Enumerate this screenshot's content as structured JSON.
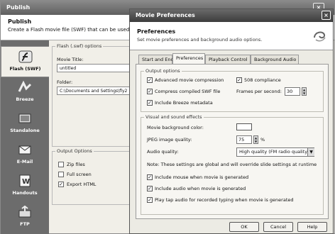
{
  "publish": {
    "title": "Publish",
    "header_title": "Publish",
    "header_subtitle": "Create a Flash movie file (SWF) that can be used indo",
    "close_glyph": "×",
    "sidebar": [
      {
        "label": "Flash (SWF)",
        "icon": "flash-icon",
        "active": true
      },
      {
        "label": "Breeze",
        "icon": "breeze-icon",
        "active": false
      },
      {
        "label": "Standalone",
        "icon": "standalone-icon",
        "active": false
      },
      {
        "label": "E-Mail",
        "icon": "email-icon",
        "active": false
      },
      {
        "label": "Handouts",
        "icon": "handouts-icon",
        "active": false
      },
      {
        "label": "FTP",
        "icon": "ftp-icon",
        "active": false
      }
    ],
    "flash_options": {
      "legend": "Flash (.swf) options",
      "movie_title_label": "Movie Title:",
      "movie_title_value": "untitled",
      "folder_label": "Folder:",
      "folder_value": "C:\\Documents and Settings\\fly2"
    },
    "output_options": {
      "legend": "Output Options",
      "items": [
        {
          "label": "Zip files",
          "checked": false
        },
        {
          "label": "Full screen",
          "checked": false
        },
        {
          "label": "Export HTML",
          "checked": true
        }
      ]
    }
  },
  "dialog": {
    "title": "Movie Preferences",
    "close_glyph": "×",
    "header_title": "Preferences",
    "header_subtitle": "Set movie preferences and background audio options.",
    "tabs": [
      {
        "label": "Start and End",
        "active": false
      },
      {
        "label": "Preferences",
        "active": true
      },
      {
        "label": "Playback Control",
        "active": false
      },
      {
        "label": "Background Audio",
        "active": false
      }
    ],
    "output_group": {
      "legend": "Output options",
      "advanced_compression": {
        "label": "Advanced movie compression",
        "checked": true
      },
      "swf_508": {
        "label": "508 compliance",
        "checked": true
      },
      "compress_swf": {
        "label": "Compress compiled SWF file",
        "checked": true
      },
      "frames_label": "Frames per second:",
      "frames_value": "30",
      "include_breeze": {
        "label": "Include Breeze metadata",
        "checked": true
      }
    },
    "visual_group": {
      "legend": "Visual and sound effects",
      "bg_color_label": "Movie background color:",
      "bg_color": "#ffffff",
      "jpeg_label": "JPEG image quality:",
      "jpeg_value": "75",
      "jpeg_unit": "%",
      "audio_label": "Audio quality:",
      "audio_value": "High quality (FM radio quality)",
      "note": "Note: These settings are global and will override slide settings at runtime",
      "include_mouse": {
        "label": "Include mouse when movie is generated",
        "checked": true
      },
      "include_audio": {
        "label": "Include audio when movie is generated",
        "checked": true
      },
      "play_tap": {
        "label": "Play tap audio for recorded typing when movie is generated",
        "checked": true
      }
    },
    "buttons": {
      "ok": "OK",
      "cancel": "Cancel",
      "help": "Help"
    },
    "check_glyph": "✓"
  }
}
